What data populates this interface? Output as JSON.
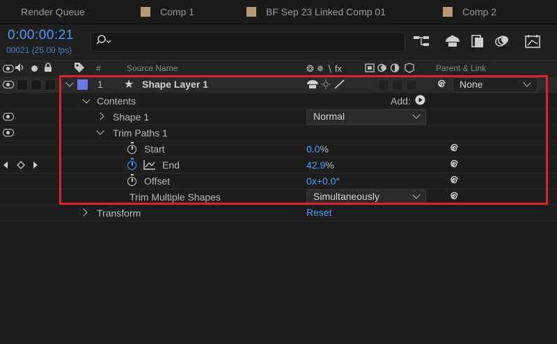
{
  "tabs": [
    {
      "label": "Render Queue",
      "has_swatch": false
    },
    {
      "label": "Comp 1",
      "has_swatch": true
    },
    {
      "label": "BF Sep 23 Linked Comp 01",
      "has_swatch": true
    },
    {
      "label": "Comp 2",
      "has_swatch": true
    }
  ],
  "time": {
    "timecode": "0:00:00:21",
    "frames": "00021 (25.00 fps)"
  },
  "search": {
    "placeholder": ""
  },
  "header": {
    "hash": "#",
    "source_name": "Source Name",
    "switches": "❂ ✵ ∖ fx",
    "parent_link": "Parent & Link"
  },
  "layer": {
    "number": "1",
    "star": "★",
    "name": "Shape Layer 1",
    "parent": "None"
  },
  "contents": {
    "label": "Contents",
    "add_label": "Add:"
  },
  "shape": {
    "label": "Shape 1",
    "blend_mode": "Normal"
  },
  "trim": {
    "label": "Trim Paths 1",
    "start": {
      "label": "Start",
      "value": "0.0",
      "unit": "%"
    },
    "end": {
      "label": "End",
      "value": "42.9",
      "unit": "%"
    },
    "offset": {
      "label": "Offset",
      "value": "0x+0.0",
      "unit": "°"
    },
    "multiple": {
      "label": "Trim Multiple Shapes",
      "value": "Simultaneously"
    }
  },
  "transform": {
    "label": "Transform",
    "reset": "Reset"
  },
  "colors": {
    "accent": "#4a9dff",
    "highlight": "#e0232b",
    "label_color": "#6b76e8"
  }
}
